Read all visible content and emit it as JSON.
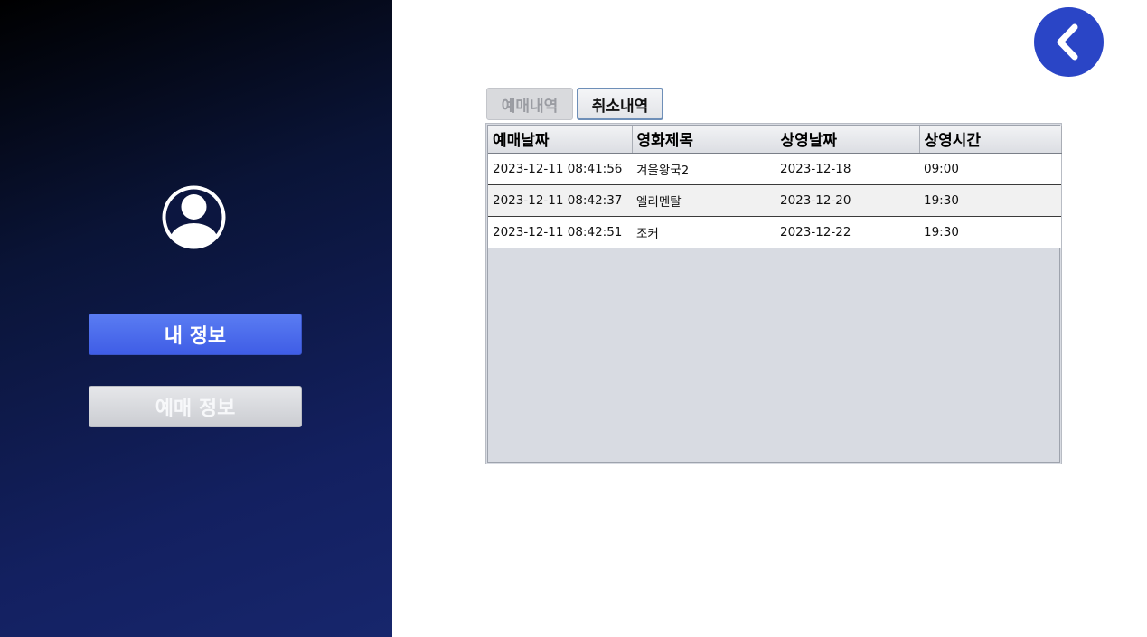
{
  "sidebar": {
    "avatar_icon": "user-circle-icon",
    "my_info_label": "내 정보",
    "booking_info_label": "예매 정보"
  },
  "header": {
    "back_icon": "chevron-left-icon"
  },
  "tabs": [
    {
      "label": "예매내역",
      "active": false
    },
    {
      "label": "취소내역",
      "active": true
    }
  ],
  "table": {
    "columns": [
      "예매날짜",
      "영화제목",
      "상영날짜",
      "상영시간"
    ],
    "rows": [
      [
        "2023-12-11 08:41:56",
        "겨울왕국2",
        "2023-12-18",
        "09:00"
      ],
      [
        "2023-12-11 08:42:37",
        "엘리멘탈",
        "2023-12-20",
        "19:30"
      ],
      [
        "2023-12-11 08:42:51",
        "조커",
        "2023-12-22",
        "19:30"
      ]
    ]
  },
  "colors": {
    "accent": "#2a45c6",
    "primary_button": "#4a6cee",
    "sidebar_dark": "#000000",
    "sidebar_light": "#17266c"
  }
}
